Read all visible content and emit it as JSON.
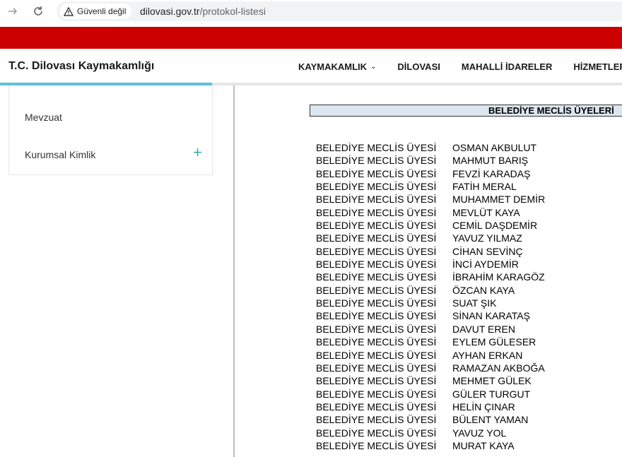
{
  "browser": {
    "security_label": "Güvenli değil",
    "url_domain": "dilovasi.gov.tr",
    "url_path": "/protokol-listesi"
  },
  "colors": {
    "brand_red": "#cc0000",
    "accent_teal": "#5bc0de",
    "header_blue": "#dce6f1"
  },
  "site": {
    "title": "T.C. Dilovası Kaymakamlığı",
    "menu": [
      {
        "label": "KAYMAKAMLIK"
      },
      {
        "label": "DİLOVASI"
      },
      {
        "label": "MAHALLİ İDARELER"
      },
      {
        "label": "HİZMETLER"
      }
    ]
  },
  "sidebar": {
    "items": [
      {
        "label": "Mevzuat"
      },
      {
        "label": "Kurumsal Kimlik"
      }
    ]
  },
  "content": {
    "section_title": "BELEDİYE MECLİS ÜYELERİ",
    "members": [
      {
        "role": "BELEDİYE MECLİS ÜYESİ",
        "name": "OSMAN AKBULUT"
      },
      {
        "role": "BELEDİYE MECLİS ÜYESİ",
        "name": "MAHMUT BARIŞ"
      },
      {
        "role": "BELEDİYE MECLİS ÜYESİ",
        "name": "FEVZİ KARADAŞ"
      },
      {
        "role": "BELEDİYE MECLİS ÜYESİ",
        "name": "FATİH MERAL"
      },
      {
        "role": "BELEDİYE MECLİS ÜYESİ",
        "name": "MUHAMMET DEMİR"
      },
      {
        "role": "BELEDİYE MECLİS ÜYESİ",
        "name": "MEVLÜT KAYA"
      },
      {
        "role": "BELEDİYE MECLİS ÜYESİ",
        "name": "CEMİL DAŞDEMİR"
      },
      {
        "role": "BELEDİYE MECLİS ÜYESİ",
        "name": "YAVUZ YILMAZ"
      },
      {
        "role": "BELEDİYE MECLİS ÜYESİ",
        "name": "CİHAN SEVİNÇ"
      },
      {
        "role": "BELEDİYE MECLİS ÜYESİ",
        "name": "İNCİ AYDEMİR"
      },
      {
        "role": "BELEDİYE MECLİS ÜYESİ",
        "name": "İBRAHİM KARAGÖZ"
      },
      {
        "role": "BELEDİYE MECLİS ÜYESİ",
        "name": "ÖZCAN KAYA"
      },
      {
        "role": "BELEDİYE MECLİS ÜYESİ",
        "name": "SUAT ŞIK"
      },
      {
        "role": "BELEDİYE MECLİS ÜYESİ",
        "name": "SİNAN KARATAŞ"
      },
      {
        "role": "BELEDİYE MECLİS ÜYESİ",
        "name": "DAVUT EREN"
      },
      {
        "role": "BELEDİYE MECLİS ÜYESİ",
        "name": "EYLEM GÜLESER"
      },
      {
        "role": "BELEDİYE MECLİS ÜYESİ",
        "name": "AYHAN ERKAN"
      },
      {
        "role": "BELEDİYE MECLİS ÜYESİ",
        "name": "RAMAZAN AKBOĞA"
      },
      {
        "role": "BELEDİYE MECLİS ÜYESİ",
        "name": "MEHMET GÜLEK"
      },
      {
        "role": "BELEDİYE MECLİS ÜYESİ",
        "name": "GÜLER TURGUT"
      },
      {
        "role": "BELEDİYE MECLİS ÜYESİ",
        "name": "HELİN ÇINAR"
      },
      {
        "role": "BELEDİYE MECLİS ÜYESİ",
        "name": "BÜLENT YAMAN"
      },
      {
        "role": "BELEDİYE MECLİS ÜYESİ",
        "name": "YAVUZ YOL"
      },
      {
        "role": "BELEDİYE MECLİS ÜYESİ",
        "name": "MURAT KAYA"
      }
    ]
  }
}
